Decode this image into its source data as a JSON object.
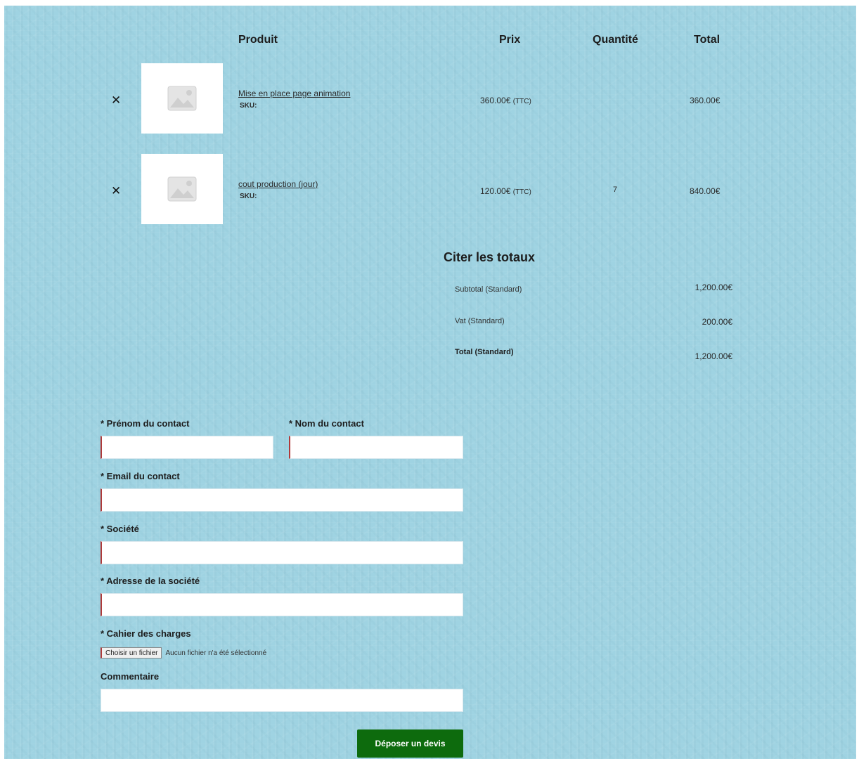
{
  "cart": {
    "headers": {
      "product": "Produit",
      "price": "Prix",
      "quantity": "Quantité",
      "total": "Total"
    },
    "items": [
      {
        "remove_icon": "✕",
        "thumbnail_icon": "image-placeholder-icon",
        "name": "Mise en place page animation",
        "sku_label": "SKU:",
        "price": "360.00€",
        "price_suffix": "(TTC)",
        "quantity": "",
        "total": "360.00€"
      },
      {
        "remove_icon": "✕",
        "thumbnail_icon": "image-placeholder-icon",
        "name": "cout production (jour)",
        "sku_label": "SKU:",
        "price": "120.00€",
        "price_suffix": "(TTC)",
        "quantity": "7",
        "total": "840.00€"
      }
    ]
  },
  "totals": {
    "title": "Citer les totaux",
    "rows": [
      {
        "label": "Subtotal (Standard)",
        "value": "1,200.00€"
      },
      {
        "label": "Vat (Standard)",
        "value": "200.00€"
      },
      {
        "label": "Total (Standard)",
        "value": "1,200.00€"
      }
    ]
  },
  "form": {
    "first_name_label": "* Prénom du contact",
    "last_name_label": "* Nom du contact",
    "email_label": "* Email du contact",
    "company_label": "* Société",
    "company_address_label": "* Adresse de la société",
    "specs_label": "* Cahier des charges",
    "file_button_label": "Choisir un fichier",
    "file_status": "Aucun fichier n'a été sélectionné",
    "comment_label": "Commentaire",
    "submit_label": "Déposer un devis"
  },
  "colors": {
    "background": "#9fd3e2",
    "submit_button": "#0d6b0d",
    "required_marker": "#b03a3a"
  }
}
